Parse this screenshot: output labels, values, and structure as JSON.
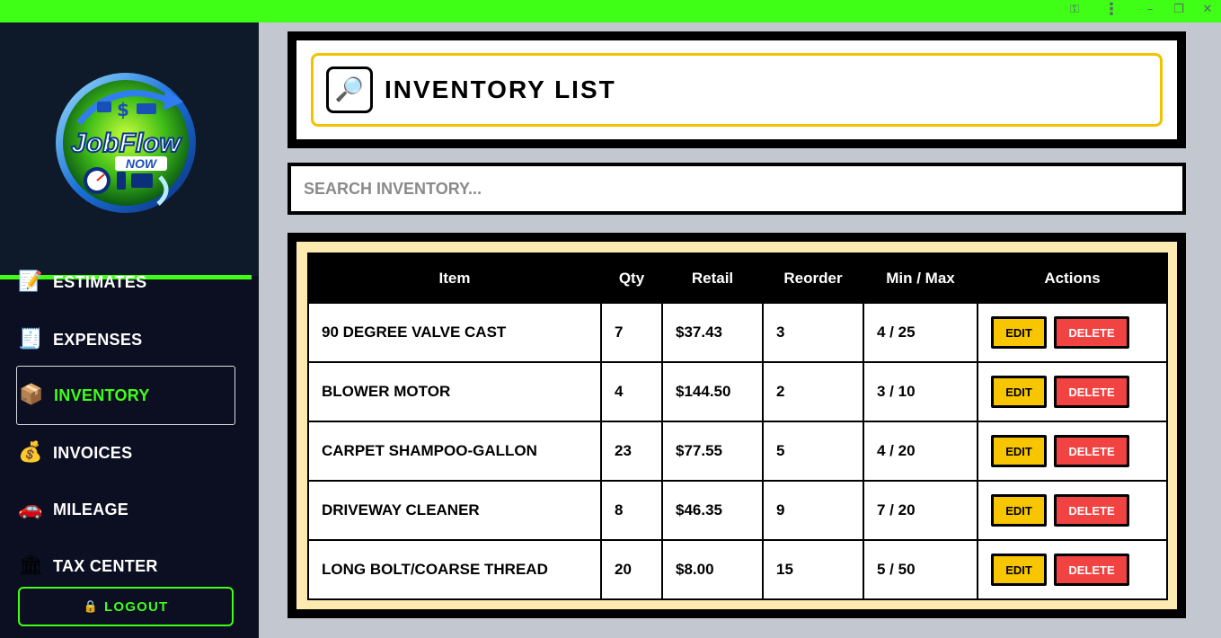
{
  "window": {
    "controls": [
      {
        "name": "key-icon",
        "glyph": "⚿"
      },
      {
        "name": "more-icon",
        "glyph": "⋮"
      },
      {
        "name": "minimize-icon",
        "glyph": "–"
      },
      {
        "name": "restore-icon",
        "glyph": "❐"
      },
      {
        "name": "close-icon",
        "glyph": "✕"
      }
    ]
  },
  "brand": {
    "logo_text": "JobFlow",
    "logo_subtext": "NOW"
  },
  "sidebar": {
    "items": [
      {
        "label": "ESTIMATES",
        "icon": "📝",
        "icon_name": "memo-icon"
      },
      {
        "label": "EXPENSES",
        "icon": "🧾",
        "icon_name": "receipt-icon"
      },
      {
        "label": "INVENTORY",
        "icon": "📦",
        "icon_name": "package-icon"
      },
      {
        "label": "INVOICES",
        "icon": "💰",
        "icon_name": "money-bag-icon"
      },
      {
        "label": "MILEAGE",
        "icon": "🚗",
        "icon_name": "car-icon"
      },
      {
        "label": "TAX CENTER",
        "icon": "🏛",
        "icon_name": "bank-icon"
      }
    ],
    "active": "INVENTORY",
    "logout_label": "LOGOUT",
    "logout_icon": "🔒"
  },
  "header": {
    "title": "INVENTORY LIST",
    "icon": "🔎"
  },
  "search": {
    "placeholder": "SEARCH INVENTORY...",
    "value": ""
  },
  "table": {
    "columns": [
      "Item",
      "Qty",
      "Retail",
      "Reorder",
      "Min / Max",
      "Actions"
    ],
    "rows": [
      {
        "item": "90 DEGREE VALVE CAST",
        "qty": "7",
        "retail": "$37.43",
        "reorder": "3",
        "minmax": "4 / 25"
      },
      {
        "item": "BLOWER MOTOR",
        "qty": "4",
        "retail": "$144.50",
        "reorder": "2",
        "minmax": "3 / 10"
      },
      {
        "item": "CARPET SHAMPOO-GALLON",
        "qty": "23",
        "retail": "$77.55",
        "reorder": "5",
        "minmax": "4 / 20"
      },
      {
        "item": "DRIVEWAY CLEANER",
        "qty": "8",
        "retail": "$46.35",
        "reorder": "9",
        "minmax": "7 / 20"
      },
      {
        "item": "LONG BOLT/COARSE THREAD",
        "qty": "20",
        "retail": "$8.00",
        "reorder": "15",
        "minmax": "5 / 50"
      }
    ],
    "edit_label": "EDIT",
    "delete_label": "DELETE"
  },
  "colors": {
    "accent_green": "#3fff17",
    "sidebar_bg": "#0b0f21",
    "highlight_yellow": "#f2c200",
    "edit_yellow": "#f7c600",
    "delete_red": "#f24343",
    "table_frame": "#fdeab0"
  }
}
